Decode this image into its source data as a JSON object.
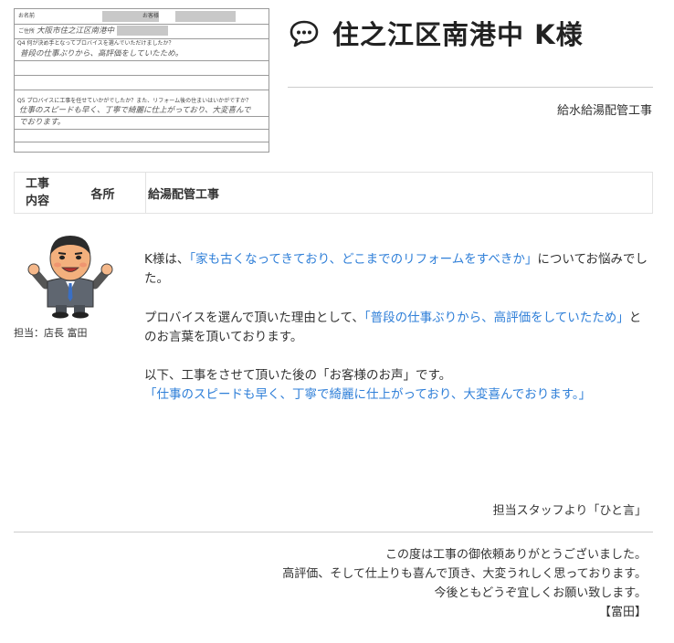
{
  "survey_form": {
    "name_label": "お名前",
    "age_label": "お客様",
    "address_label": "ご住所",
    "address_value": "大阪市住之江区南港中",
    "q4_label": "Q4 何が決め手となってプロバイスを選んでいただけましたか？",
    "q4_answer": "普段の仕事ぶりから、高評価をしていたため。",
    "q5_label": "Q5 プロバイスに工事を任せていかがでしたか？また、リフォーム後の住まいはいかがですか？",
    "q5_answer_line1": "仕事のスピードも早く、丁寧で綺麗に仕上がっており、大変喜んで",
    "q5_answer_line2": "でおります。"
  },
  "header": {
    "title": "住之江区南港中 K様",
    "category": "給水給湯配管工事"
  },
  "work_table": {
    "label_line1": "工事",
    "label_line2": "内容",
    "location": "各所",
    "content": "給湯配管工事"
  },
  "staff": {
    "caption": "担当：店長 富田"
  },
  "body": {
    "p1_prefix": "K様は、",
    "p1_quote": "「家も古くなってきており、どこまでのリフォームをすべきか」",
    "p1_suffix": "についてお悩みでした。",
    "p2_prefix": "プロバイスを選んで頂いた理由として、",
    "p2_quote": "「普段の仕事ぶりから、高評価をしていたため」",
    "p2_suffix": "とのお言葉を頂いております。",
    "p3_line1": "以下、工事をさせて頂いた後の「お客様のお声」です。",
    "p3_quote": "「仕事のスピードも早く、丁寧で綺麗に仕上がっており、大変喜んでおります。」"
  },
  "staff_message": {
    "heading": "担当スタッフより「ひと言」",
    "line1": "この度は工事の御依頼ありがとうございました。",
    "line2": "高評価、そして仕上りも喜んで頂き、大変うれしく思っております。",
    "line3": "今後ともどうぞ宜しくお願い致します。",
    "signature": "【富田】"
  },
  "colors": {
    "accent_blue": "#2f7fd8",
    "text": "#333333",
    "rule": "#cccccc"
  },
  "icons": {
    "title_icon": "speech-bubble-icon",
    "staff_avatar": "staff-mascot-illustration"
  }
}
